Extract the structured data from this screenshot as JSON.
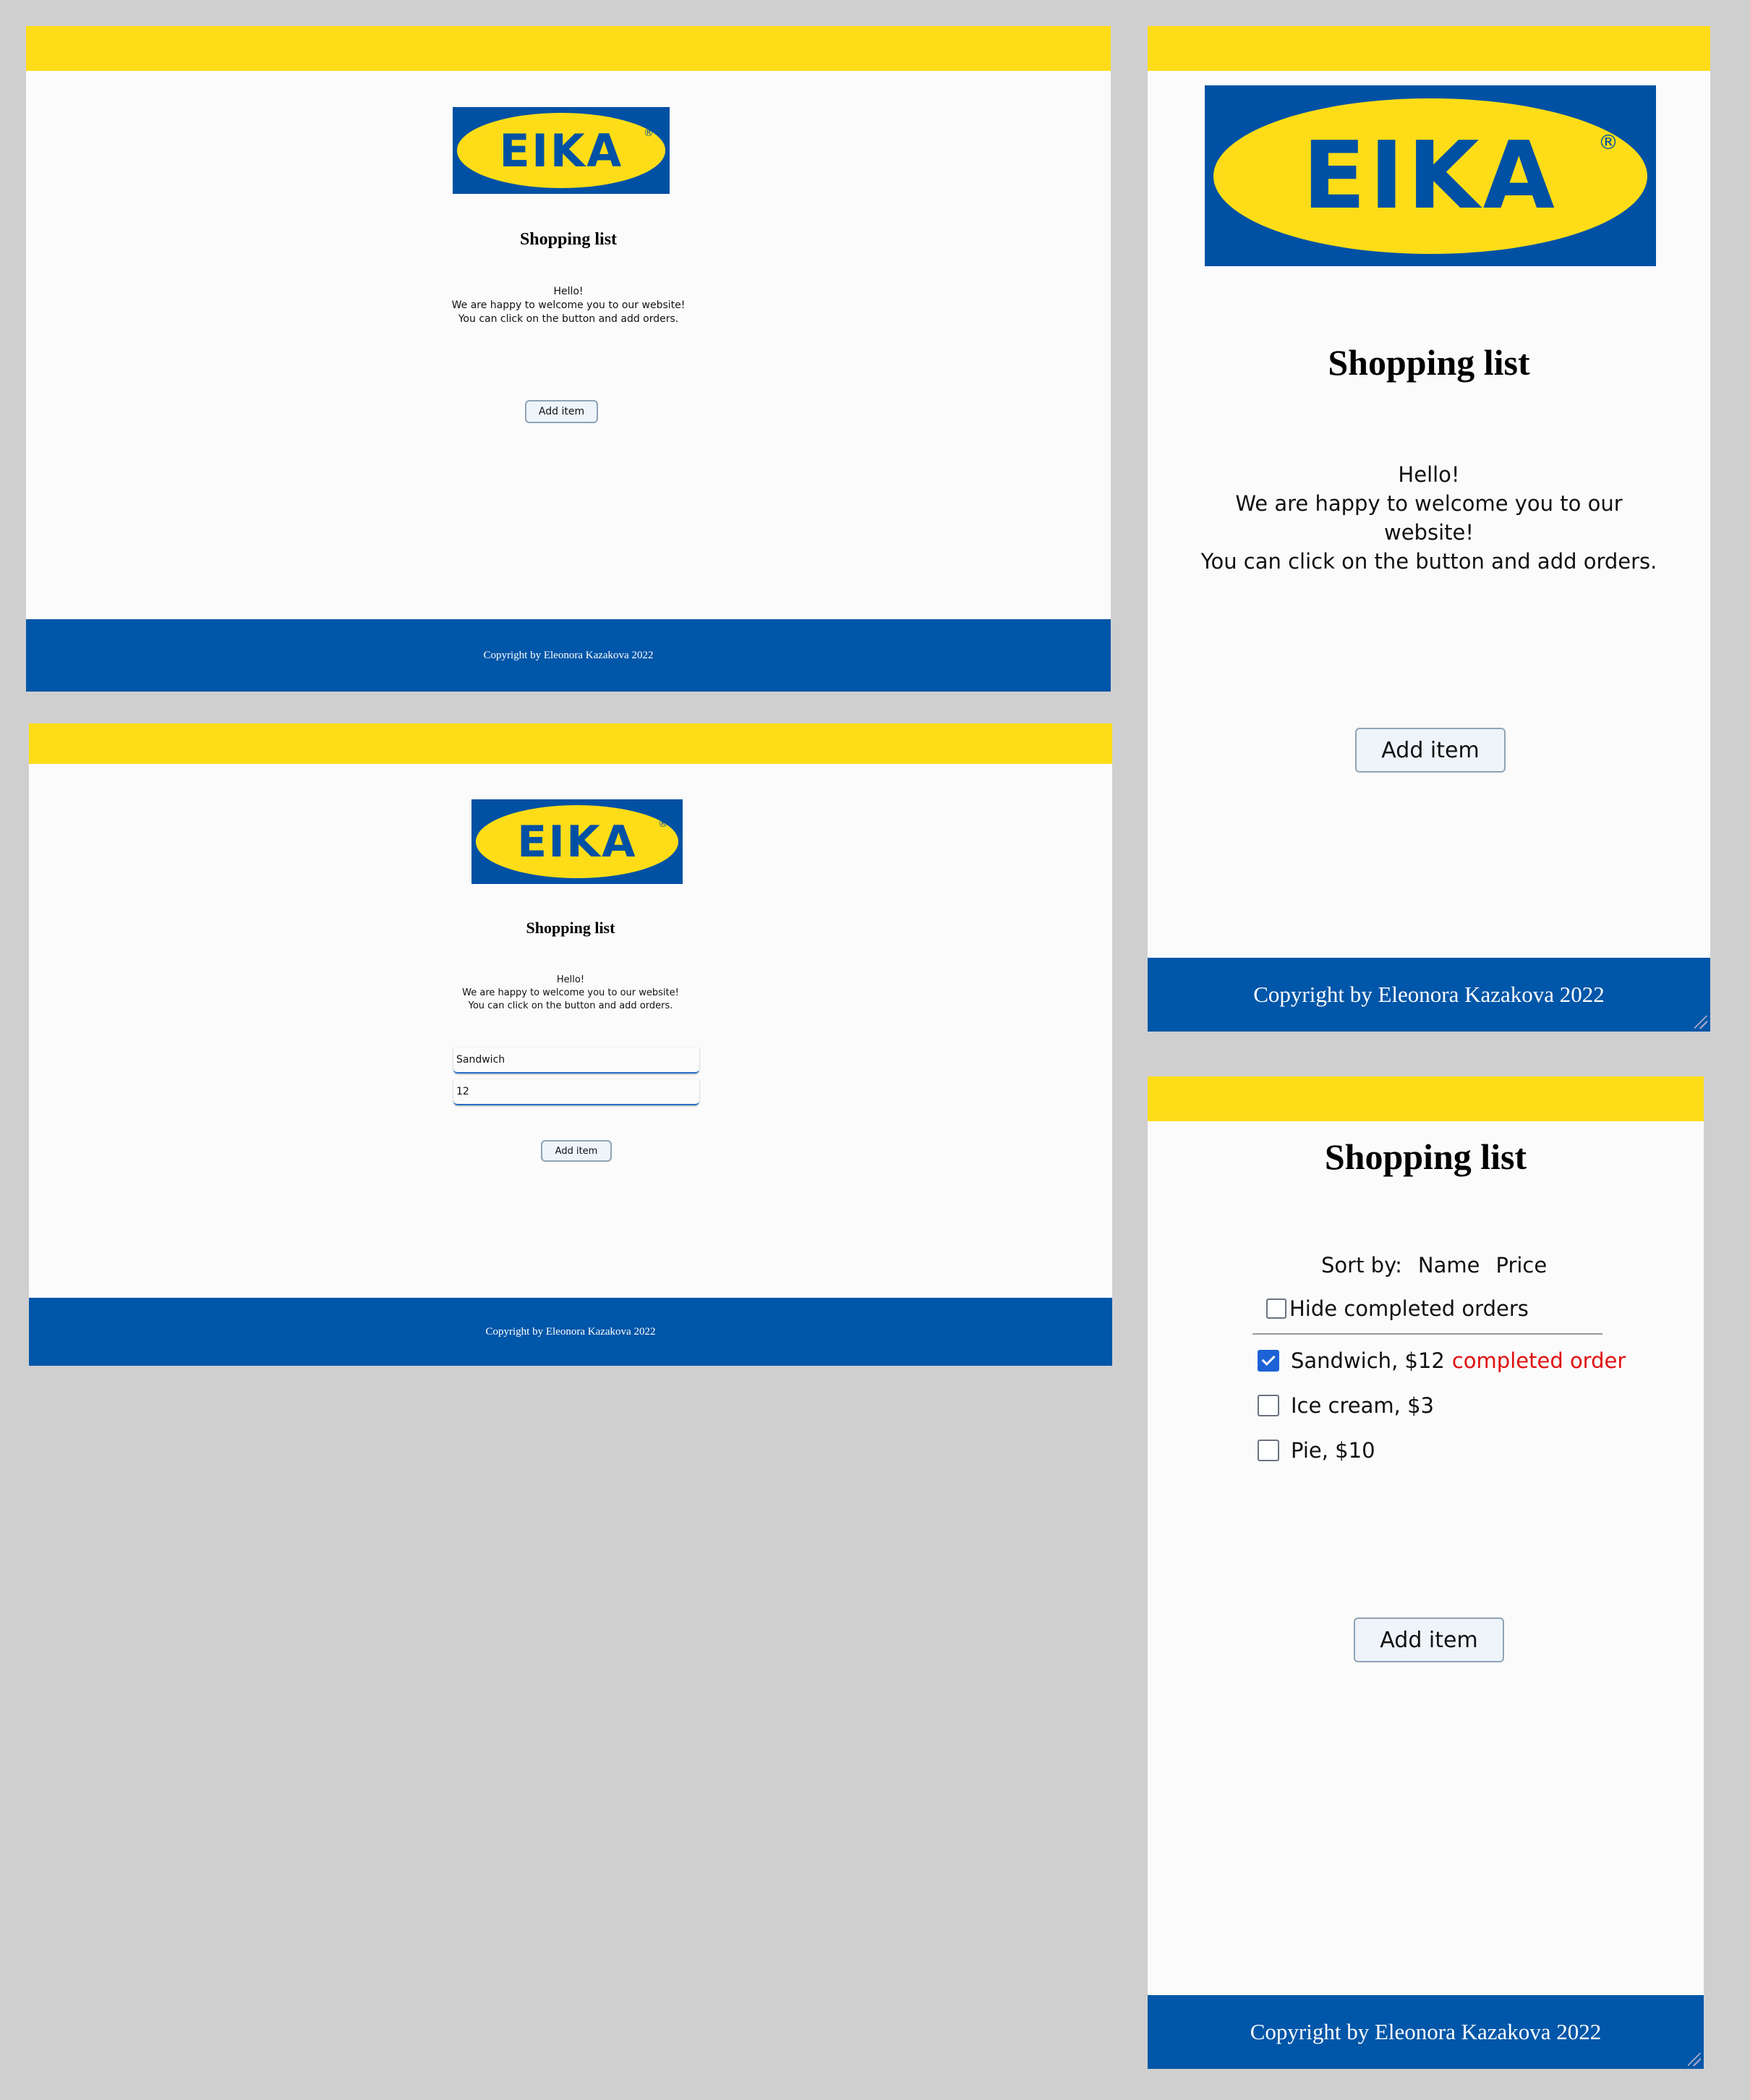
{
  "brand": {
    "logo_text": "EIKA",
    "registered": "®"
  },
  "page": {
    "title": "Shopping list",
    "greeting": [
      "Hello!",
      "We are happy to welcome you to our website!",
      "You can click on the button and add orders."
    ],
    "greeting_wrapped": [
      "Hello!",
      "We are happy to welcome you to our",
      "website!",
      "You can click on the button and add orders."
    ],
    "add_button": "Add item",
    "footer": "Copyright by Eleonora Kazakova 2022"
  },
  "form": {
    "name_value": "Sandwich",
    "price_value": "12"
  },
  "list": {
    "hide_completed_label": "Hide completed orders",
    "sort_label": "Sort by:",
    "sort_name": "Name",
    "sort_price": "Price",
    "items": [
      {
        "text": "Sandwich, $12",
        "checked": true,
        "note": "completed order"
      },
      {
        "text": "Ice cream, $3",
        "checked": false,
        "note": ""
      },
      {
        "text": "Pie, $10",
        "checked": false,
        "note": ""
      }
    ]
  },
  "colors": {
    "yellow": "#fedd18",
    "blue": "#0056a8",
    "background": "#d0cfd0",
    "completed": "#e01010"
  }
}
